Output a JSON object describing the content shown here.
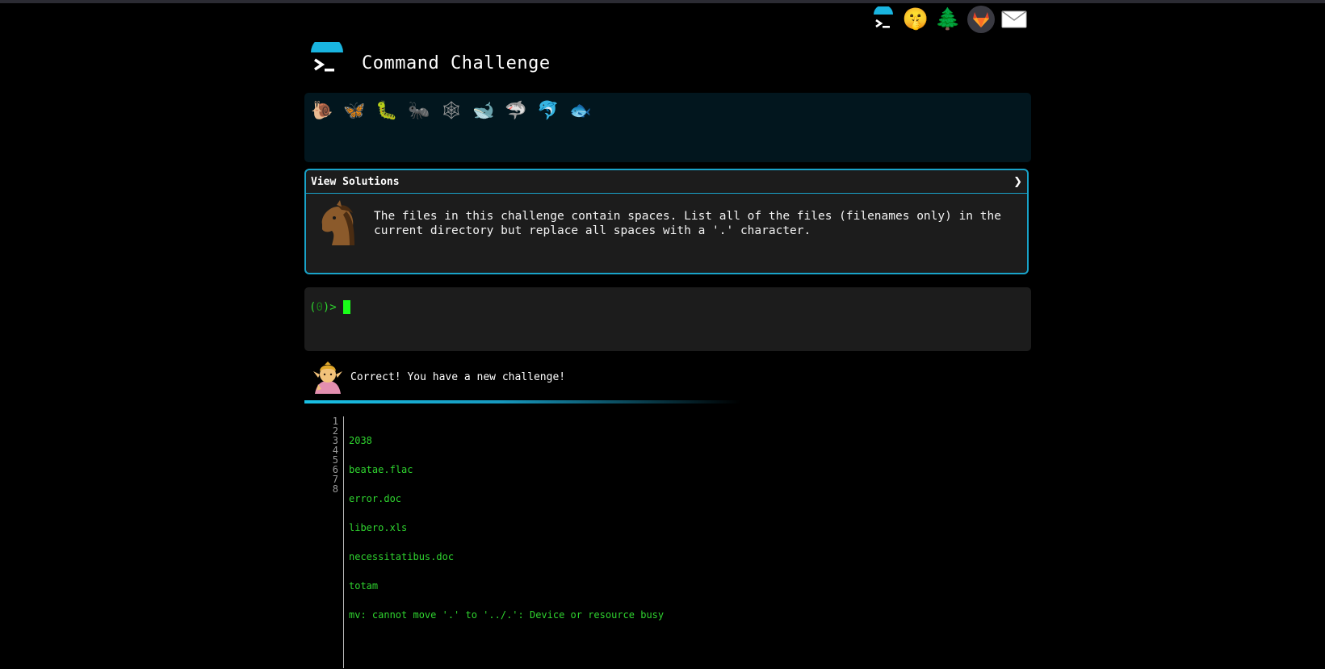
{
  "title": "Command Challenge",
  "top_icons": [
    {
      "name": "terminal-logo-icon",
      "glyph": ""
    },
    {
      "name": "shush-face-icon",
      "glyph": "🤫"
    },
    {
      "name": "tree-icon",
      "glyph": "🌲"
    },
    {
      "name": "gitlab-icon",
      "glyph": "🦊"
    },
    {
      "name": "mail-icon",
      "glyph": "✉"
    }
  ],
  "levels": [
    {
      "name": "snail-icon",
      "glyph": "🐌"
    },
    {
      "name": "butterfly-icon",
      "glyph": "🦋"
    },
    {
      "name": "caterpillar-icon",
      "glyph": "🐛"
    },
    {
      "name": "ant-icon",
      "glyph": "🐜"
    },
    {
      "name": "web-icon",
      "glyph": "🕸"
    },
    {
      "name": "whale-icon",
      "glyph": "🐋"
    },
    {
      "name": "shark-icon",
      "glyph": "🦈"
    },
    {
      "name": "dolphin-icon",
      "glyph": "🐬"
    },
    {
      "name": "fish-icon",
      "glyph": "🐟"
    }
  ],
  "solutions": {
    "header": "View Solutions",
    "chevron": "❯",
    "description": "The files in this challenge contain spaces. List all of the files (filenames only) in the current directory but replace all spaces with a '.' character."
  },
  "terminal": {
    "prompt_open": "(",
    "prompt_count": "0",
    "prompt_close": ")>"
  },
  "feedback": {
    "message": "Correct! You have a new challenge!"
  },
  "output": {
    "line_numbers": [
      "1",
      "2",
      "3",
      "4",
      "5",
      "6",
      "7",
      "8"
    ],
    "lines": [
      "2038",
      "beatae.flac",
      "error.doc",
      "libero.xls",
      "necessitatibus.doc",
      "totam",
      "mv: cannot move '.' to '../.': Device or resource busy",
      ""
    ]
  },
  "colors": {
    "accent": "#19a3c9",
    "prompt_green": "#2fd42f",
    "panel_bg": "#1c1c1c",
    "levels_bg": "#02161e"
  }
}
